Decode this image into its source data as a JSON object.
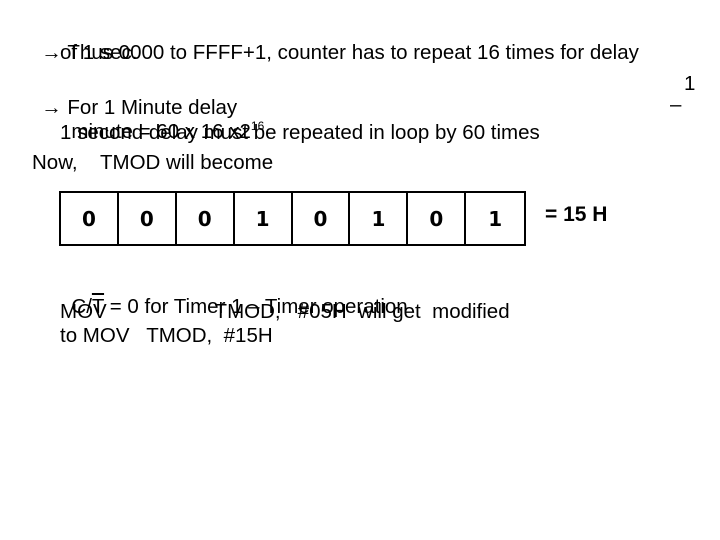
{
  "lines": {
    "l1_arrow": "→",
    "l1": "Thus 0000 to FFFF+1, counter has to repeat 16 times for delay",
    "l2": "of 1 sec.",
    "l3_arrow": "→",
    "l3": "For 1 Minute delay",
    "l3_right": "1",
    "l4": "minute = 60 x 16 x2",
    "l4_sup": "16",
    "l4_right": "–",
    "l5": "1 second delay must be repeated in loop by 60 times",
    "l6": "Now,    TMOD will become"
  },
  "tmod_bits": [
    "0",
    "0",
    "0",
    "1",
    "0",
    "1",
    "0",
    "1"
  ],
  "tmod_value": "= 15 H",
  "notes": {
    "ct_prefix": "C/",
    "ct_overline": "T",
    "ct_rest": " = 0 for Timer 1 – Timer operation",
    "mov1": "MOV                   TMOD,   #05H  will get  modified",
    "mov2": "to MOV   TMOD,  #15H"
  }
}
